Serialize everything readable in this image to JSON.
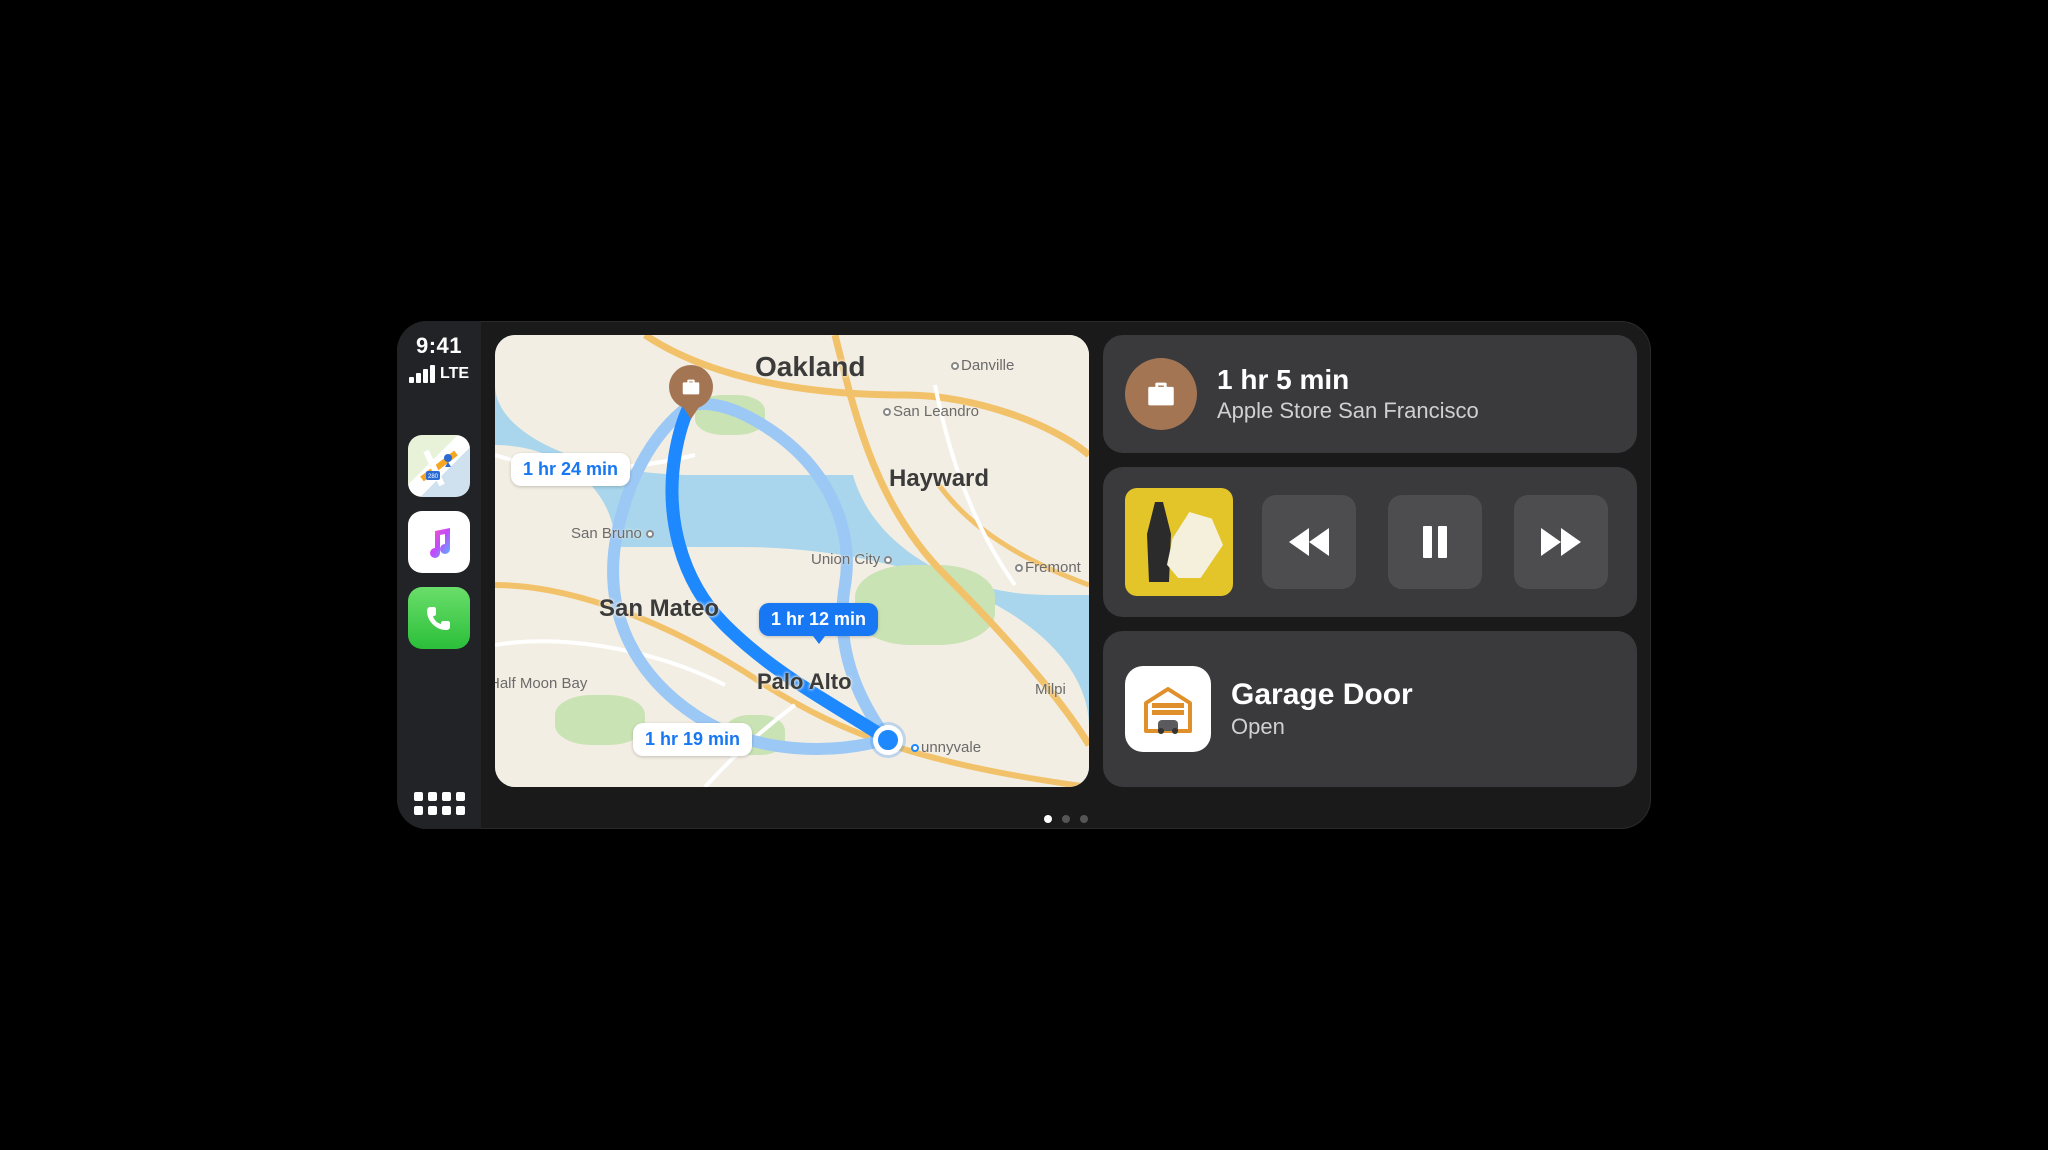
{
  "status": {
    "time": "9:41",
    "network": "LTE"
  },
  "sidebar": {
    "apps": [
      {
        "id": "maps-app-icon"
      },
      {
        "id": "music-app-icon"
      },
      {
        "id": "phone-app-icon"
      }
    ]
  },
  "map": {
    "cities_major": {
      "oakland": "Oakland",
      "hayward": "Hayward",
      "san_mateo": "San Mateo",
      "palo_alto": "Palo Alto"
    },
    "cities_minor": {
      "danville": "Danville",
      "san_leandro": "San Leandro",
      "san_bruno": "San Bruno",
      "union_city": "Union City",
      "fremont": "Fremont",
      "half_moon_bay": "Half Moon Bay",
      "milpitas": "Milpi",
      "sunnyvale": "unnyvale"
    },
    "routes": {
      "r1": "1 hr 24 min",
      "r2": "1 hr 12 min",
      "r3": "1 hr 19 min"
    },
    "destination_icon": "briefcase-icon"
  },
  "destination": {
    "eta": "1 hr 5 min",
    "name": "Apple Store San Francisco",
    "icon": "briefcase-icon"
  },
  "media": {
    "album_color": "#e3c52a",
    "controls": {
      "prev": "rewind-icon",
      "playpause": "pause-icon",
      "next": "forward-icon"
    }
  },
  "home": {
    "device": "Garage Door",
    "state": "Open",
    "icon": "garage-icon"
  },
  "pager": {
    "count": 3,
    "active": 0
  },
  "colors": {
    "card_bg": "#3a3a3c",
    "brown": "#a47553",
    "blue": "#1877f2",
    "water": "#a9d6ec",
    "land": "#f3eee3"
  }
}
